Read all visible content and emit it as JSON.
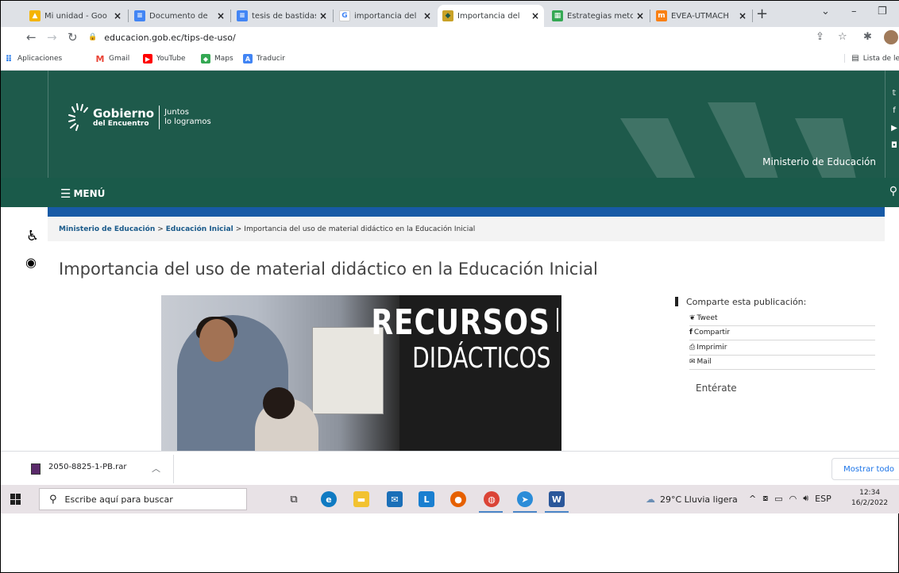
{
  "tabs": [
    {
      "title": "Mi unidad - Goo",
      "icon": "google-drive-icon",
      "active": false
    },
    {
      "title": "Documento de",
      "icon": "google-docs-icon",
      "active": false
    },
    {
      "title": "tesis de bastidas",
      "icon": "google-docs-icon",
      "active": false
    },
    {
      "title": "importancia del",
      "icon": "google-search-icon",
      "active": false
    },
    {
      "title": "Importancia del",
      "icon": "education-ministry-icon",
      "active": true
    },
    {
      "title": "Estrategias meto",
      "icon": "image-icon",
      "active": false
    },
    {
      "title": "EVEA-UTMACH",
      "icon": "moodle-icon",
      "active": false
    }
  ],
  "tab_close": "×",
  "new_tab": "+",
  "window_controls": {
    "dropdown": "⌄",
    "minimize": "–",
    "restore": "❐"
  },
  "toolbar": {
    "url": "educacion.gob.ec/tips-de-uso/"
  },
  "bookmarks": {
    "apps": "Aplicaciones",
    "items": [
      {
        "label": "Gmail",
        "icon": "gmail-icon",
        "color": "#ea4335"
      },
      {
        "label": "YouTube",
        "icon": "youtube-icon",
        "color": "#ff0000"
      },
      {
        "label": "Maps",
        "icon": "maps-icon",
        "color": "#34a853"
      },
      {
        "label": "Traducir",
        "icon": "translate-icon",
        "color": "#4285f4"
      }
    ],
    "reading_list": "Lista de le"
  },
  "site": {
    "logo_main": "Gobierno",
    "logo_sub": "del Encuentro",
    "logo_motto_1": "Juntos",
    "logo_motto_2": "lo logramos",
    "ministry": "Ministerio de Educación",
    "menu": "MENÚ",
    "header_color": "#1e5a4b",
    "accent_blue": "#175aa6"
  },
  "breadcrumb": {
    "items": [
      "Ministerio de Educación",
      "Educación Inicial"
    ],
    "current": "Importancia del uso de material didáctico en la Educación Inicial",
    "separator": ">"
  },
  "article": {
    "title": "Importancia del uso de material didáctico en la Educación Inicial",
    "banner_line1": "RECURSOS",
    "banner_line2": "DIDÁCTICOS"
  },
  "sidebar": {
    "share_heading": "Comparte esta publicación:",
    "share_items": [
      {
        "label": "Tweet",
        "icon": "twitter-icon",
        "glyph": "🐦"
      },
      {
        "label": "Compartir",
        "icon": "facebook-icon",
        "glyph": "f"
      },
      {
        "label": "Imprimir",
        "icon": "print-icon",
        "glyph": "⎙"
      },
      {
        "label": "Mail",
        "icon": "mail-icon",
        "glyph": "✉"
      }
    ],
    "enterate": "Entérate"
  },
  "download": {
    "filename": "2050-8825-1-PB.rar",
    "show_all": "Mostrar todo"
  },
  "taskbar": {
    "search_placeholder": "Escribe aquí para buscar",
    "weather": "29°C  Lluvia ligera",
    "language": "ESP",
    "time": "12:34",
    "date": "16/2/2022"
  }
}
